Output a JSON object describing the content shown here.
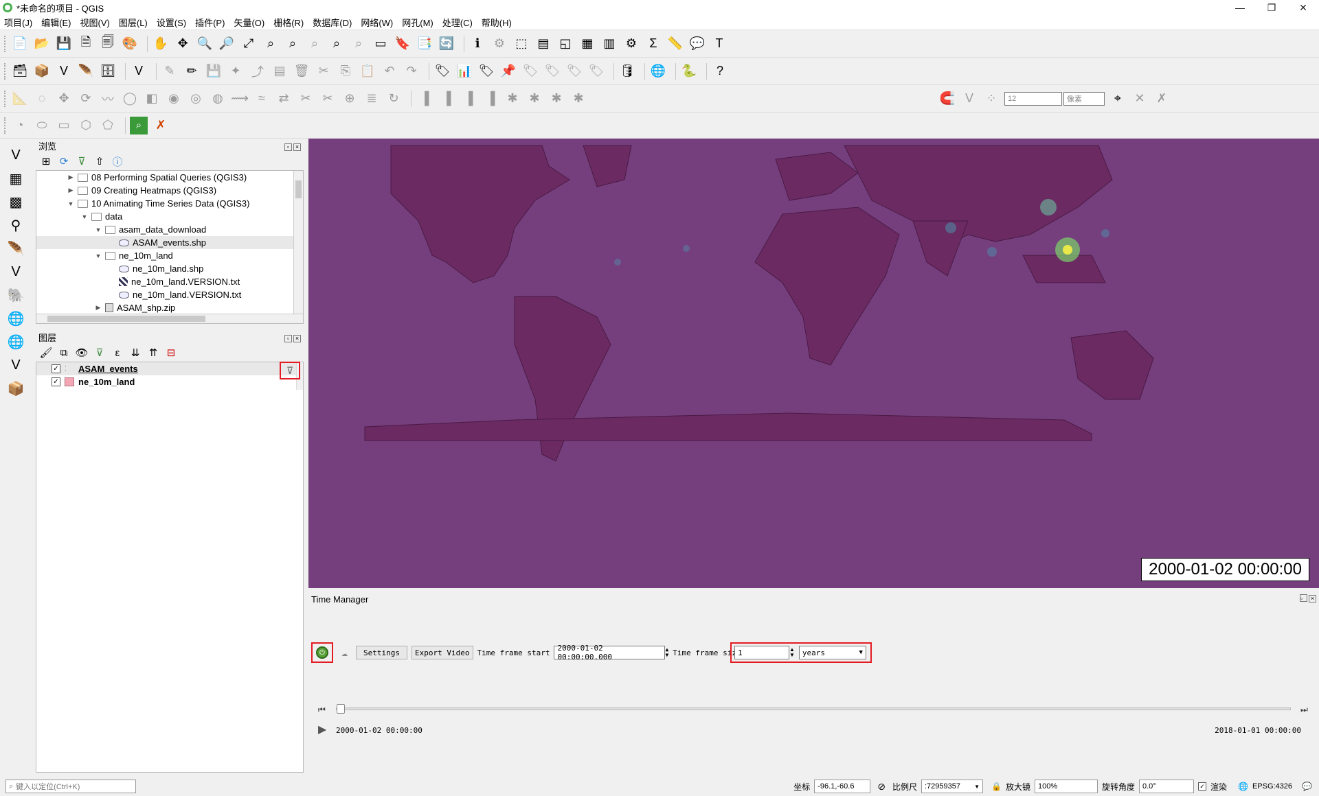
{
  "window": {
    "title": "*未命名的项目 - QGIS",
    "min": "—",
    "max": "❐",
    "close": "✕"
  },
  "menu": [
    "项目(J)",
    "编辑(E)",
    "视图(V)",
    "图层(L)",
    "设置(S)",
    "插件(P)",
    "矢量(O)",
    "栅格(R)",
    "数据库(D)",
    "网络(W)",
    "网孔(M)",
    "处理(C)",
    "帮助(H)"
  ],
  "snapping": {
    "value": "12",
    "unit": "像素"
  },
  "browser": {
    "title": "浏览",
    "items": [
      {
        "label": "08 Performing Spatial Queries (QGIS3)"
      },
      {
        "label": "09 Creating Heatmaps (QGIS3)"
      },
      {
        "label": "10 Animating Time Series Data (QGIS3)"
      },
      {
        "label": "data"
      },
      {
        "label": "asam_data_download"
      },
      {
        "label": "ASAM_events.shp"
      },
      {
        "label": "ne_10m_land"
      },
      {
        "label": "ne_10m_land.shp"
      },
      {
        "label": "ne_10m_land.VERSION.txt"
      },
      {
        "label": "ne_10m_land.VERSION.txt"
      },
      {
        "label": "ASAM_shp.zip"
      }
    ]
  },
  "layers": {
    "title": "图层",
    "items": [
      {
        "label": "ASAM_events",
        "checked": true
      },
      {
        "label": "ne_10m_land",
        "checked": true,
        "swatch": "#f4a6b4"
      }
    ]
  },
  "map": {
    "timestamp": "2000-01-02 00:00:00",
    "background": "#753f7e",
    "land": "#6b2a62"
  },
  "time_manager": {
    "title": "Time Manager",
    "settings_label": "Settings",
    "export_label": "Export Video",
    "start_label": "Time frame start",
    "start_value": "2000-01-02 00:00:00.000",
    "size_label": "Time frame size",
    "size_value": "1",
    "size_unit": "years",
    "start_time": "2000-01-02 00:00:00",
    "end_time": "2018-01-01 00:00:00",
    "progress": 0.0
  },
  "status": {
    "locator_placeholder": "键入以定位(Ctrl+K)",
    "coord_label": "坐标",
    "coord_value": "-96.1,-60.6",
    "scale_label": "比例尺",
    "scale_value": ":72959357",
    "magnifier_label": "放大镜",
    "magnifier_value": "100%",
    "rotation_label": "旋转角度",
    "rotation_value": "0.0°",
    "render_label": "渲染",
    "crs": "EPSG:4326"
  }
}
